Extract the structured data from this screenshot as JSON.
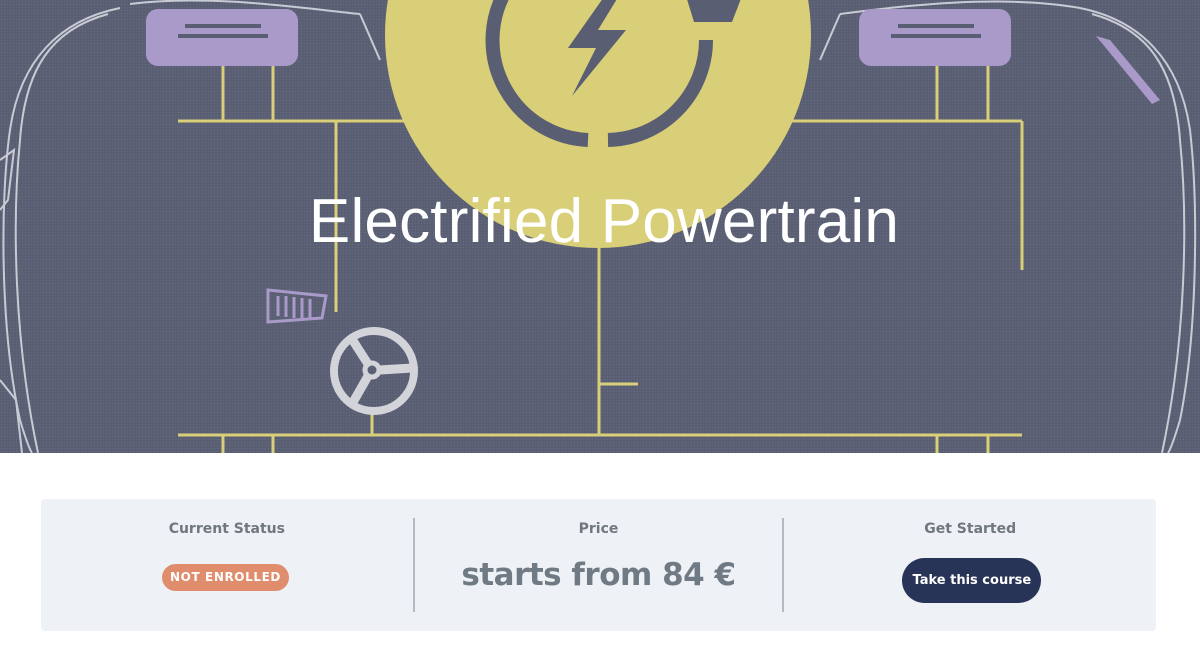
{
  "hero": {
    "title": "Electrified Powertrain",
    "colors": {
      "background": "#5a5e72",
      "accent_yellow": "#d8cf78",
      "accent_purple": "#a99ac9",
      "outline": "#c9cbd4"
    },
    "icons": [
      "lightning-bolt-icon",
      "steering-wheel-icon",
      "pedal-icon",
      "seat-icon"
    ]
  },
  "info_bar": {
    "status": {
      "label": "Current Status",
      "badge": "NOT ENROLLED",
      "badge_color": "#df8d6d"
    },
    "price": {
      "label": "Price",
      "value": "starts from 84 €"
    },
    "get_started": {
      "label": "Get Started",
      "button": "Take this course",
      "button_color": "#283457"
    }
  }
}
